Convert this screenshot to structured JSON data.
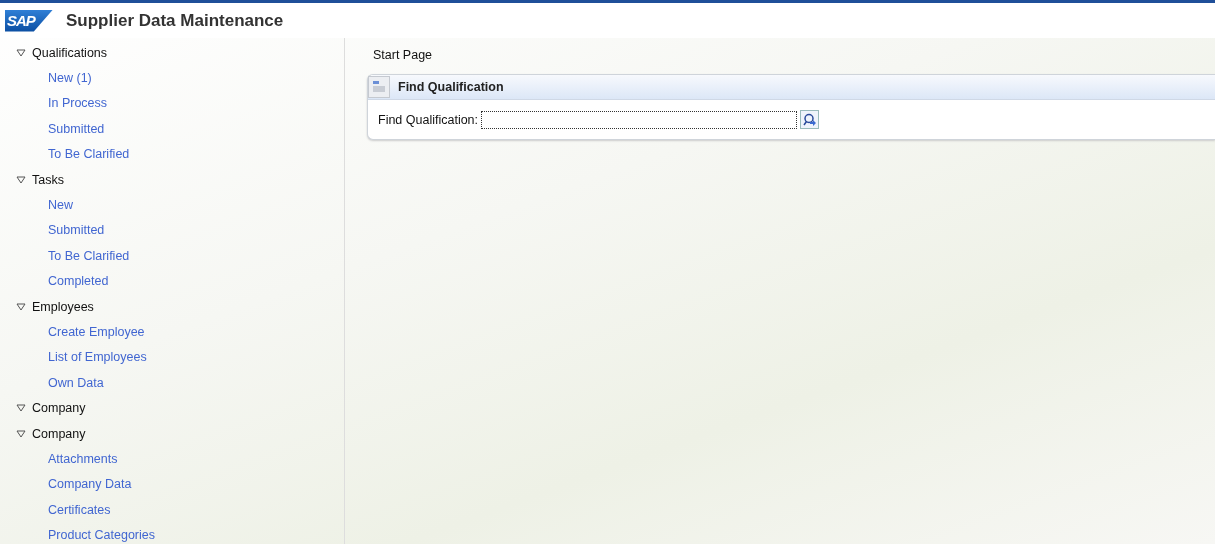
{
  "header": {
    "logo": "SAP",
    "title": "Supplier Data Maintenance"
  },
  "navigation": [
    {
      "label": "Qualifications",
      "expanded": true,
      "children": [
        {
          "label": "New (1)"
        },
        {
          "label": "In Process"
        },
        {
          "label": "Submitted"
        },
        {
          "label": "To Be Clarified"
        }
      ]
    },
    {
      "label": "Tasks",
      "expanded": true,
      "children": [
        {
          "label": "New"
        },
        {
          "label": "Submitted"
        },
        {
          "label": "To Be Clarified"
        },
        {
          "label": "Completed"
        }
      ]
    },
    {
      "label": "Employees",
      "expanded": true,
      "children": [
        {
          "label": "Create Employee"
        },
        {
          "label": "List of Employees"
        },
        {
          "label": "Own Data"
        }
      ]
    },
    {
      "label": "Company",
      "expanded": true
    },
    {
      "label": "Company",
      "expanded": true,
      "children": [
        {
          "label": "Attachments"
        },
        {
          "label": "Company Data"
        },
        {
          "label": "Certificates"
        },
        {
          "label": "Product Categories"
        }
      ]
    }
  ],
  "main": {
    "breadcrumb": "Start Page",
    "panel": {
      "title": "Find Qualification",
      "field_label": "Find Qualification:"
    }
  }
}
